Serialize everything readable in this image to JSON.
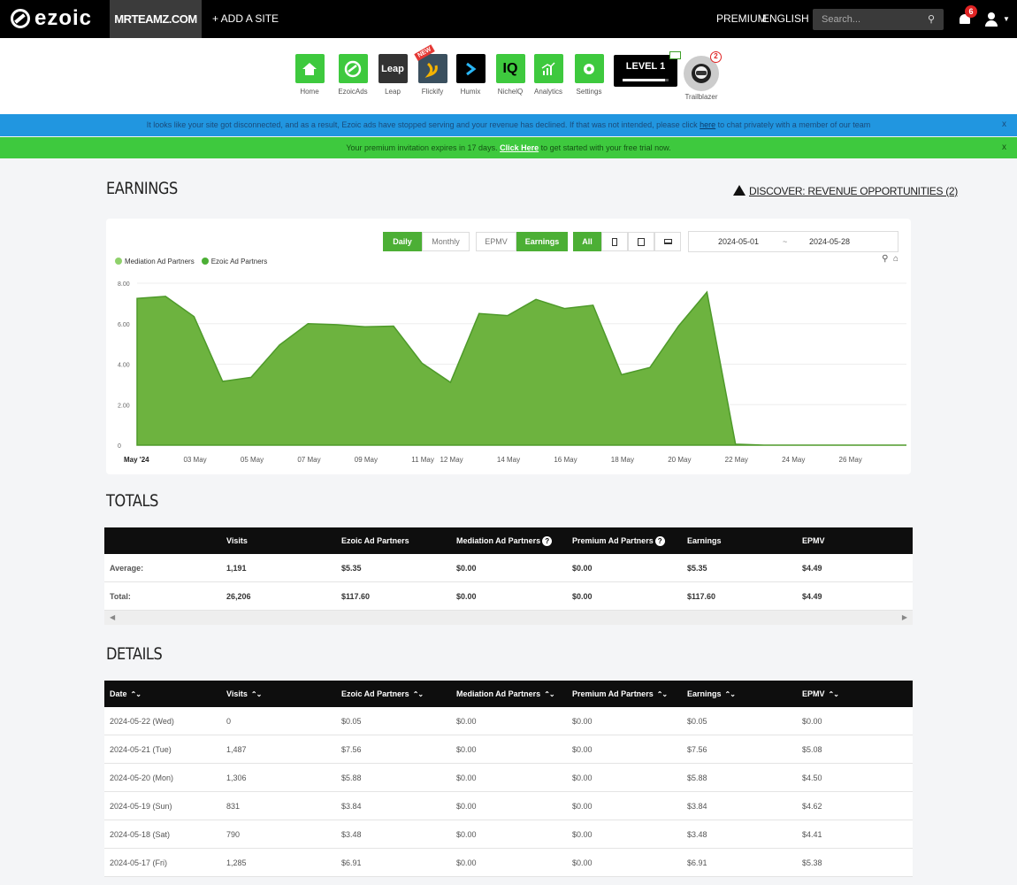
{
  "nav": {
    "logo_text": "ezoic",
    "site": "MRTEAMZ.COM",
    "add_site": "+ ADD A SITE",
    "premium": "PREMIUM",
    "language": "ENGLISH",
    "search_placeholder": "Search...",
    "notifications_count": "6"
  },
  "apps": [
    {
      "label": "Home",
      "icon": "home-icon",
      "color": "#3ec93e"
    },
    {
      "label": "EzoicAds",
      "icon": "ezoic-icon",
      "color": "#3ec93e"
    },
    {
      "label": "Leap",
      "icon": "leap-icon",
      "color": "#333333",
      "text": "Leap"
    },
    {
      "label": "Flickify",
      "icon": "flickify-icon",
      "color": "#3a4f5e",
      "badge": "NEW"
    },
    {
      "label": "Humix",
      "icon": "humix-icon",
      "color": "#000000"
    },
    {
      "label": "NichelQ",
      "icon": "nicheiq-icon",
      "color": "#3ec93e",
      "text": "IQ"
    },
    {
      "label": "Analytics",
      "icon": "analytics-icon",
      "color": "#3ec93e"
    },
    {
      "label": "Settings",
      "icon": "settings-icon",
      "color": "#3ec93e"
    }
  ],
  "level": {
    "label": "LEVEL 1",
    "progress": 0.92
  },
  "trailblazer": {
    "label": "Trailblazer",
    "badge": "2"
  },
  "banners": {
    "disconnected_before": "It looks like your site got disconnected, and as a result, Ezoic ads have stopped serving and your revenue has declined. If that was not intended, please click ",
    "disconnected_link": "here",
    "disconnected_after": " to chat privately with a member of our team",
    "premium_before": "Your premium invitation expires in 17 days. ",
    "premium_link": "Click Here",
    "premium_after": " to get started with your free trial now.",
    "close": "x"
  },
  "earnings": {
    "title": "EARNINGS",
    "discover": "DISCOVER: REVENUE OPPORTUNITIES (2)",
    "buttons": {
      "daily": "Daily",
      "monthly": "Monthly",
      "epmv": "EPMV",
      "earnings": "Earnings",
      "all": "All"
    },
    "date_start": "2024-05-01",
    "date_sep": "~",
    "date_end": "2024-05-28",
    "legend": [
      "Mediation Ad Partners",
      "Ezoic Ad Partners"
    ],
    "legend_colors": [
      "#8fd16b",
      "#4caf35"
    ]
  },
  "chart_data": {
    "type": "area",
    "x_labels": [
      "May '24",
      "03 May",
      "05 May",
      "07 May",
      "09 May",
      "11 May",
      "12 May",
      "14 May",
      "16 May",
      "18 May",
      "20 May",
      "22 May",
      "24 May",
      "26 May"
    ],
    "y_ticks": [
      "8.00",
      "6.00",
      "4.00",
      "2.00",
      "0"
    ],
    "ylim": [
      0,
      8
    ],
    "series": [
      {
        "name": "Ezoic Ad Partners",
        "color": "#6db33f",
        "x": [
          "2024-05-01",
          "2024-05-02",
          "2024-05-03",
          "2024-05-04",
          "2024-05-05",
          "2024-05-06",
          "2024-05-07",
          "2024-05-08",
          "2024-05-09",
          "2024-05-10",
          "2024-05-11",
          "2024-05-12",
          "2024-05-13",
          "2024-05-14",
          "2024-05-15",
          "2024-05-16",
          "2024-05-17",
          "2024-05-18",
          "2024-05-19",
          "2024-05-20",
          "2024-05-21",
          "2024-05-22",
          "2024-05-23",
          "2024-05-24",
          "2024-05-25",
          "2024-05-26",
          "2024-05-27",
          "2024-05-28"
        ],
        "values": [
          7.25,
          7.35,
          6.35,
          3.15,
          3.35,
          4.95,
          6.0,
          5.95,
          5.85,
          5.88,
          4.05,
          3.1,
          6.5,
          6.4,
          7.2,
          6.75,
          6.91,
          3.48,
          3.84,
          5.88,
          7.56,
          0.05,
          0.0,
          0.0,
          0.0,
          0.0,
          0.0,
          0.0
        ]
      }
    ]
  },
  "totals": {
    "title": "TOTALS",
    "columns": [
      "",
      "Visits",
      "Ezoic Ad Partners",
      "Mediation Ad Partners",
      "Premium Ad Partners",
      "Earnings",
      "EPMV"
    ],
    "rows": [
      [
        "Average:",
        "1,191",
        "$5.35",
        "$0.00",
        "$0.00",
        "$5.35",
        "$4.49"
      ],
      [
        "Total:",
        "26,206",
        "$117.60",
        "$0.00",
        "$0.00",
        "$117.60",
        "$4.49"
      ]
    ]
  },
  "details": {
    "title": "DETAILS",
    "columns": [
      "Date",
      "Visits",
      "Ezoic Ad Partners",
      "Mediation Ad Partners",
      "Premium Ad Partners",
      "Earnings",
      "EPMV"
    ],
    "rows": [
      [
        "2024-05-22 (Wed)",
        "0",
        "$0.05",
        "$0.00",
        "$0.00",
        "$0.05",
        "$0.00"
      ],
      [
        "2024-05-21 (Tue)",
        "1,487",
        "$7.56",
        "$0.00",
        "$0.00",
        "$7.56",
        "$5.08"
      ],
      [
        "2024-05-20 (Mon)",
        "1,306",
        "$5.88",
        "$0.00",
        "$0.00",
        "$5.88",
        "$4.50"
      ],
      [
        "2024-05-19 (Sun)",
        "831",
        "$3.84",
        "$0.00",
        "$0.00",
        "$3.84",
        "$4.62"
      ],
      [
        "2024-05-18 (Sat)",
        "790",
        "$3.48",
        "$0.00",
        "$0.00",
        "$3.48",
        "$4.41"
      ],
      [
        "2024-05-17 (Fri)",
        "1,285",
        "$6.91",
        "$0.00",
        "$0.00",
        "$6.91",
        "$5.38"
      ]
    ]
  }
}
